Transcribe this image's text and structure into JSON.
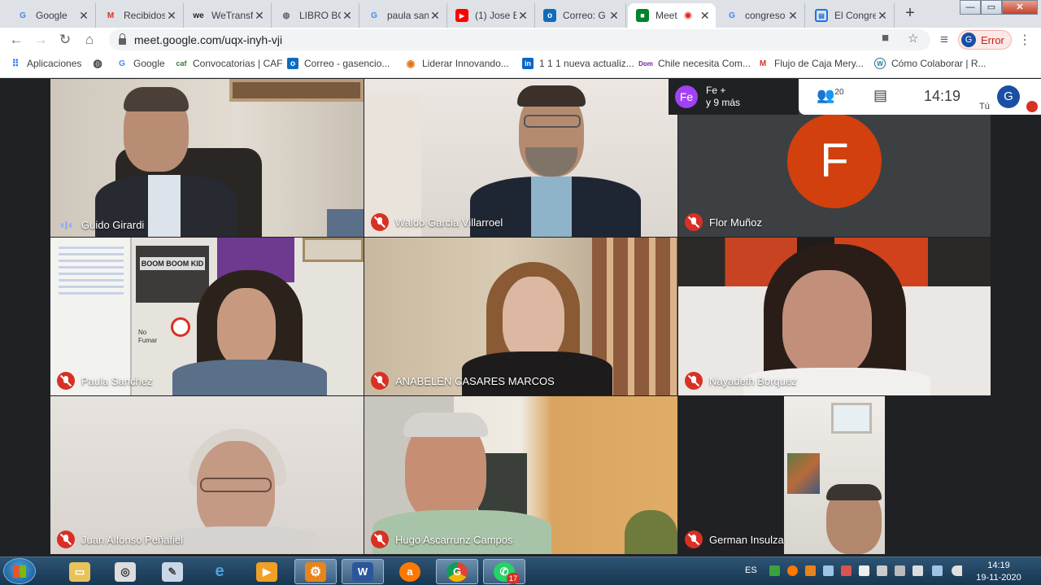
{
  "tabs": [
    {
      "title": "Google",
      "icon": "google-icon",
      "color": "#4285f4"
    },
    {
      "title": "Recibidos",
      "icon": "gmail-icon",
      "color": "#d93025"
    },
    {
      "title": "WeTransf",
      "icon": "wetransfer-icon",
      "color": "#202124"
    },
    {
      "title": "LIBRO BO",
      "icon": "globe-icon",
      "color": "#5f6368"
    },
    {
      "title": "paula san",
      "icon": "google-icon",
      "color": "#4285f4"
    },
    {
      "title": "(1) Jose E",
      "icon": "youtube-icon",
      "color": "#ff0000"
    },
    {
      "title": "Correo: G",
      "icon": "outlook-icon",
      "color": "#0f6cbd"
    },
    {
      "title": "Meet",
      "icon": "meet-icon",
      "color": "#00832d"
    },
    {
      "title": "congreso",
      "icon": "google-icon",
      "color": "#4285f4"
    },
    {
      "title": "El Congre",
      "icon": "document-icon",
      "color": "#1a73e8"
    }
  ],
  "address": {
    "url": "meet.google.com/uqx-inyh-vji"
  },
  "profile": {
    "initial": "G",
    "status": "Error"
  },
  "bookmarks": [
    {
      "label": "Aplicaciones",
      "icon": "apps-grid-icon",
      "color": "#1a73e8"
    },
    {
      "label": "",
      "icon": "globe-icon",
      "color": "#3c4043"
    },
    {
      "label": "Google",
      "icon": "google-icon",
      "color": "#4285f4"
    },
    {
      "label": "Convocatorias | CAF",
      "icon": "caf-icon",
      "color": "#2e7d32"
    },
    {
      "label": "Correo - gasencio...",
      "icon": "outlook-icon",
      "color": "#0f6cbd"
    },
    {
      "label": "Liderar Innovando...",
      "icon": "chrome-icon",
      "color": "#e8710a"
    },
    {
      "label": "1 1 1 nueva actualiz...",
      "icon": "linkedin-icon",
      "color": "#0a66c2"
    },
    {
      "label": "Chile necesita Com...",
      "icon": "dom-icon",
      "color": "#7b1fa2"
    },
    {
      "label": "Flujo de Caja Mery...",
      "icon": "gmail-icon",
      "color": "#d93025"
    },
    {
      "label": "Cómo Colaborar | R...",
      "icon": "wordpress-icon",
      "color": "#21759b"
    }
  ],
  "meeting": {
    "overflow_initials": "Fe",
    "overflow_line1": "Fe +",
    "overflow_line2": "y 9 más",
    "participant_count": "20",
    "time": "14:19",
    "self_initial": "G",
    "self_label": "Tú",
    "big_avatar_initial": "F",
    "participants": [
      {
        "name": "Guido Girardi",
        "muted": false
      },
      {
        "name": "Waldo Garcia Villarroel",
        "muted": true
      },
      {
        "name": "Flor Muñoz",
        "muted": true
      },
      {
        "name": "Paula Sanchez",
        "muted": true
      },
      {
        "name": "ANABELÉN CASARES MARCOS",
        "muted": true
      },
      {
        "name": "Nayadeth Borquez",
        "muted": true
      },
      {
        "name": "Juan Alfonso Peñafiel",
        "muted": true
      },
      {
        "name": "Hugo Ascarrunz Campos",
        "muted": true
      },
      {
        "name": "German Insulza",
        "muted": true
      }
    ],
    "scene_text": {
      "sign_boom": "BOOM BOOM KID",
      "sign_no": "No",
      "sign_fumar": "Fumar"
    }
  },
  "taskbar": {
    "language": "ES",
    "time": "14:19",
    "date": "19-11-2020",
    "whatsapp_badge": "17",
    "chrome_badge": "G"
  }
}
